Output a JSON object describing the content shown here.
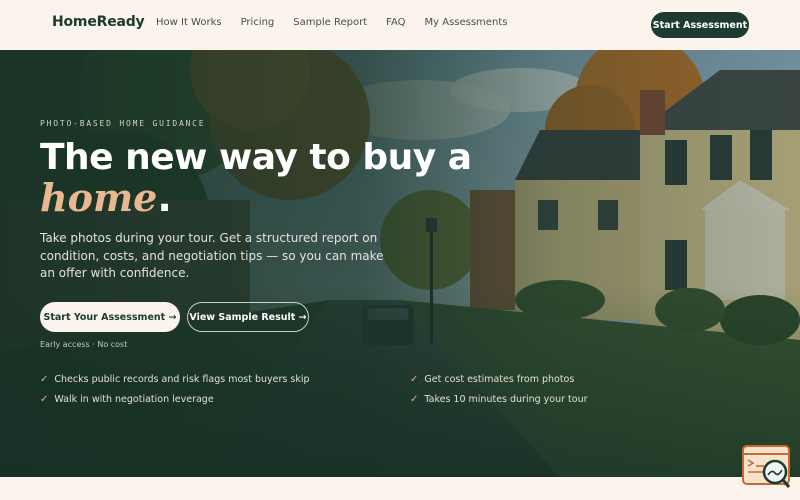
{
  "header": {
    "logo": "HomeReady",
    "nav": [
      "How It Works",
      "Pricing",
      "Sample Report",
      "FAQ",
      "My Assessments"
    ],
    "cta": "Start Assessment"
  },
  "hero": {
    "eyebrow": "PHOTO-BASED HOME GUIDANCE",
    "title_line1": "The new way to buy a",
    "title_line2": "home",
    "title_period": ".",
    "lede": "Take photos during your tour. Get a structured report on condition, costs, and negotiation tips — so you can make an offer with confidence.",
    "primary_button": "Start Your Assessment →",
    "secondary_button": "View Sample Result →",
    "fine_print": "Early access · No cost",
    "features": [
      "Checks public records and risk flags most buyers skip",
      "Get cost estimates from photos",
      "Walk in with negotiation leverage",
      "Takes 10 minutes during your tour"
    ],
    "check_glyph": "✓"
  },
  "colors": {
    "brand_dark": "#1f3a30",
    "cream": "#faf4ec",
    "accent_peach": "#e9b792"
  }
}
